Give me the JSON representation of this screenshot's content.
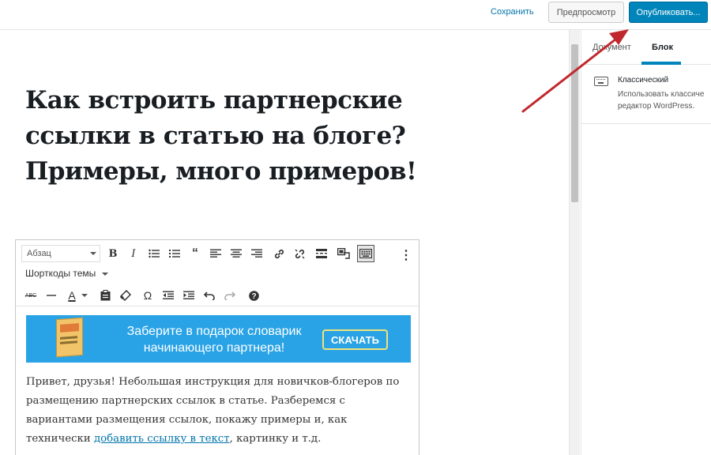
{
  "header": {
    "save_label": "Сохранить",
    "preview_label": "Предпросмотр",
    "publish_label": "Опубликовать..."
  },
  "sidebar": {
    "tabs": [
      {
        "label": "Документ"
      },
      {
        "label": "Блок"
      }
    ],
    "active_tab": "Блок",
    "block": {
      "icon": "keyboard-icon",
      "title": "Классический",
      "description_line1": "Использовать классиче",
      "description_line2": "редактор WordPress."
    }
  },
  "post": {
    "title": "Как встроить партнерские ссылки в статью на блоге? Примеры, много примеров!"
  },
  "classic_editor": {
    "format_select": "Абзац",
    "shortcodes_label": "Шорткоды темы",
    "toolbar_row1_icons": [
      "bold-icon",
      "italic-icon",
      "bullet-list-icon",
      "numbered-list-icon",
      "blockquote-icon",
      "align-left-icon",
      "align-center-icon",
      "align-right-icon",
      "link-icon",
      "unlink-icon",
      "read-more-icon",
      "shortcode-icon",
      "toolbar-toggle-icon",
      "more-options-icon"
    ],
    "toolbar_row3_icons": [
      "strikethrough-icon",
      "horizontal-line-icon",
      "text-color-icon",
      "paste-text-icon",
      "clear-formatting-icon",
      "special-character-icon",
      "outdent-icon",
      "indent-icon",
      "undo-icon",
      "redo-icon",
      "help-icon"
    ],
    "banner": {
      "text": "Заберите в подарок словарик начинающего партнера!",
      "button_label": "СКАЧАТЬ",
      "background": "#29a3e6"
    },
    "paragraph": {
      "text_before": "Привет, друзья! Небольшая инструкция для новичков-блогеров по размещению партнерских ссылок в статье. Разберемся с вариантами размещения ссылок, покажу примеры и, как технически ",
      "link_text": "добавить ссылку в текст",
      "text_after": ", картинку и т.д."
    }
  },
  "colors": {
    "accent": "#0085ba",
    "link": "#0073aa",
    "annotation_arrow": "#c0282d"
  }
}
